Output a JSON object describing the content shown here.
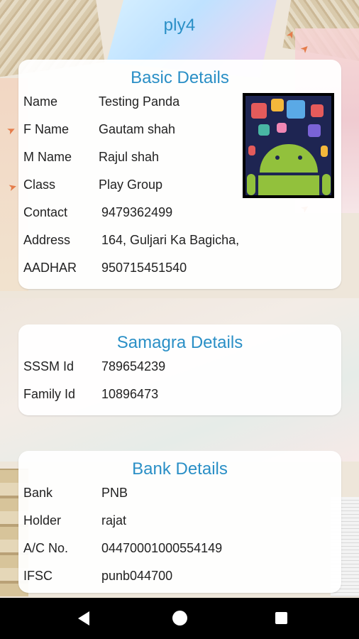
{
  "app": {
    "title": "ply4"
  },
  "basic": {
    "title": "Basic Details",
    "rows": [
      {
        "label": "Name",
        "value": "Testing Panda"
      },
      {
        "label": "F Name",
        "value": "Gautam shah"
      },
      {
        "label": "M Name",
        "value": "Rajul shah"
      },
      {
        "label": "Class",
        "value": "Play Group"
      },
      {
        "label": "Contact",
        "value": "9479362499"
      },
      {
        "label": "Address",
        "value": "164, Guljari Ka Bagicha,"
      },
      {
        "label": "AADHAR",
        "value": "950715451540"
      }
    ]
  },
  "samagra": {
    "title": "Samagra Details",
    "rows": [
      {
        "label": "SSSM Id",
        "value": "789654239"
      },
      {
        "label": "Family Id",
        "value": "10896473"
      }
    ]
  },
  "bank": {
    "title": "Bank Details",
    "rows": [
      {
        "label": "Bank",
        "value": "PNB"
      },
      {
        "label": "Holder",
        "value": "rajat"
      },
      {
        "label": "A/C No.",
        "value": "04470001000554149"
      },
      {
        "label": "IFSC",
        "value": "punb044700"
      }
    ]
  },
  "icons": {
    "photo": "android-icon",
    "back": "back-icon",
    "home": "home-icon",
    "recents": "recents-icon"
  },
  "colors": {
    "accent": "#2a8fc6",
    "android_green": "#92c13c"
  }
}
